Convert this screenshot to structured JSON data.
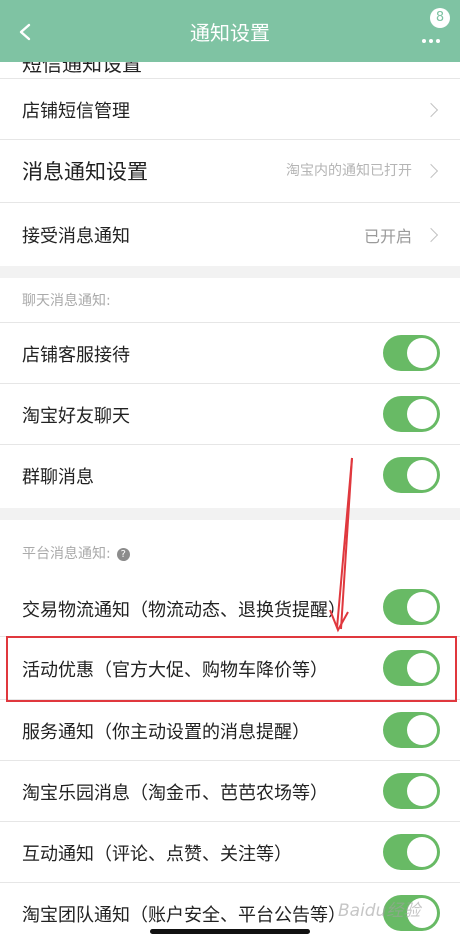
{
  "navbar": {
    "title": "通知设置",
    "back_icon": "chevron-left-icon",
    "more_icon": "more-dots-icon",
    "badge_count": "8"
  },
  "top_section": {
    "cut_off_label": "短信通知设置",
    "rows": [
      {
        "label": "店铺短信管理",
        "value": ""
      },
      {
        "label": "消息通知设置",
        "value": "淘宝内的通知已打开"
      },
      {
        "label": "接受消息通知",
        "value": "已开启"
      }
    ]
  },
  "chat_section": {
    "header": "聊天消息通知:",
    "rows": [
      {
        "label": "店铺客服接待",
        "on": true
      },
      {
        "label": "淘宝好友聊天",
        "on": true
      },
      {
        "label": "群聊消息",
        "on": true
      }
    ]
  },
  "platform_section": {
    "header": "平台消息通知:",
    "help_icon": "question-circle-icon",
    "rows": [
      {
        "label": "交易物流通知（物流动态、退换货提醒）",
        "on": true
      },
      {
        "label": "活动优惠（官方大促、购物车降价等）",
        "on": true
      },
      {
        "label": "服务通知（你主动设置的消息提醒）",
        "on": true
      },
      {
        "label": "淘宝乐园消息（淘金币、芭芭农场等）",
        "on": true
      },
      {
        "label": "互动通知（评论、点赞、关注等）",
        "on": true
      },
      {
        "label": "淘宝团队通知（账户安全、平台公告等）",
        "on": true
      }
    ]
  },
  "annotation": {
    "color": "#e0383e"
  },
  "colors": {
    "navbar": "#7fc3a3",
    "toggle_on": "#68ba65"
  },
  "watermark": "Baidu经验"
}
